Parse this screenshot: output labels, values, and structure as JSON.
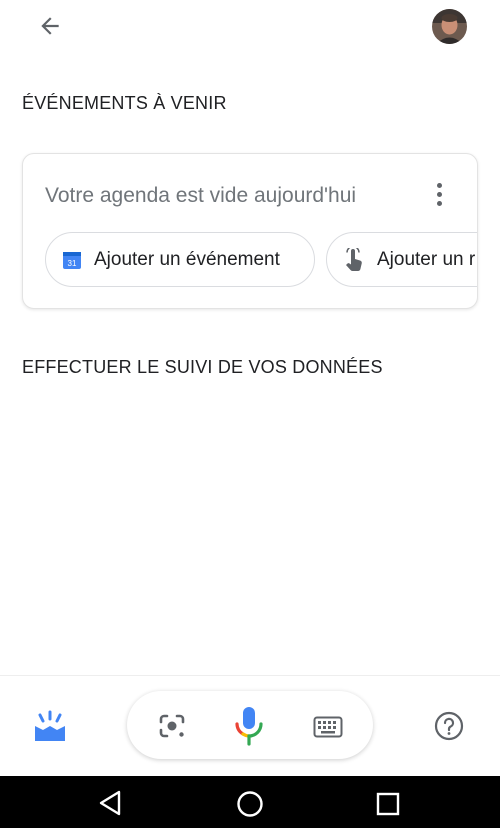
{
  "header": {
    "back_icon": "arrow-back-icon",
    "avatar_icon": "user-avatar"
  },
  "sections": {
    "upcoming_title": "ÉVÉNEMENTS À VENIR",
    "tracking_title": "EFFECTUER LE SUIVI DE VOS DONNÉES"
  },
  "agenda_card": {
    "title": "Votre agenda est vide aujourd'hui",
    "more_icon": "more-vert-icon",
    "chips": [
      {
        "label": "Ajouter un événement",
        "icon": "calendar-icon",
        "icon_text": "31"
      },
      {
        "label": "Ajouter un r",
        "icon": "touch-icon"
      }
    ]
  },
  "bottom_bar": {
    "snapshot_icon": "snapshot-icon",
    "lens_icon": "lens-icon",
    "mic_icon": "mic-icon",
    "keyboard_icon": "keyboard-icon",
    "help_icon": "help-icon"
  },
  "nav_bar": {
    "back_icon": "nav-back-icon",
    "home_icon": "nav-home-icon",
    "recents_icon": "nav-recents-icon"
  },
  "colors": {
    "google_blue": "#4285F4",
    "google_red": "#EA4335",
    "google_yellow": "#FBBC05",
    "google_green": "#34A853",
    "text_secondary": "#70757a",
    "icon_grey": "#5f6368"
  }
}
